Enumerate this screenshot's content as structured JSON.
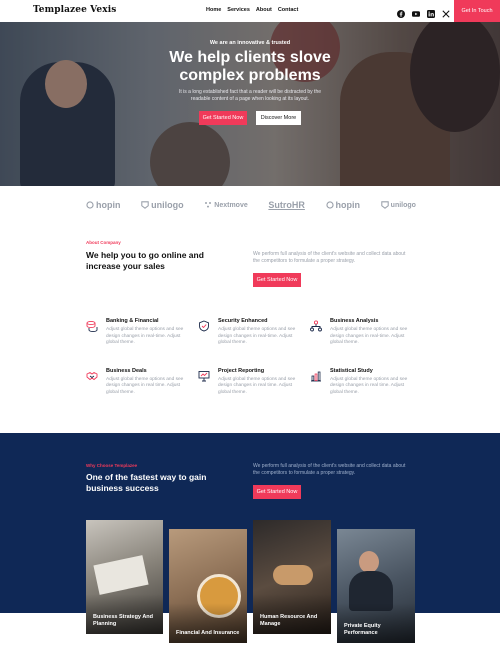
{
  "nav": {
    "brand": "Templazee Vexis",
    "menu": [
      "Home",
      "Services",
      "About",
      "Contact"
    ],
    "socials": [
      "facebook-icon",
      "youtube-icon",
      "linkedin-icon",
      "x-icon"
    ],
    "cta": "Get In Touch"
  },
  "hero": {
    "kicker": "We are an innovative & trusted",
    "title": "We help clients slove complex problems",
    "subtitle": "It is a long established fact that a reader will be distracted by the readable content of a page when looking at its layout.",
    "primary_button": "Get Started Now",
    "secondary_button": "Discover More"
  },
  "logos": [
    "hopin",
    "unilogo",
    "Nextmove",
    "SutroHR",
    "hopin",
    "unilogo"
  ],
  "about": {
    "kicker": "About Company",
    "title": "We help you to go online and increase your sales",
    "text": "We perform full analysis of the client's website and collect data about the competitors to formulate a proper strategy.",
    "button": "Get Started Now"
  },
  "features": [
    {
      "icon": "coins-icon",
      "title": "Banking & Financial",
      "desc": "Adjust global theme options and see design changes in real-time. Adjust global theme."
    },
    {
      "icon": "shield-check-icon",
      "title": "Security Enhanced",
      "desc": "Adjust global theme options and see design changes in real-time. Adjust global theme."
    },
    {
      "icon": "org-chart-icon",
      "title": "Business Analysis",
      "desc": "Adjust global theme options and see design changes in real-time. Adjust global theme."
    },
    {
      "icon": "handshake-icon",
      "title": "Business Deals",
      "desc": "Adjust global theme options and see design changes in real time. Adjust global theme."
    },
    {
      "icon": "presentation-icon",
      "title": "Project Reporting",
      "desc": "Adjust global theme options and see design changes in real time. Adjust global theme."
    },
    {
      "icon": "bar-chart-icon",
      "title": "Statistical Study",
      "desc": "Adjust global theme options and see design changes in real time. Adjust global theme."
    }
  ],
  "why": {
    "kicker": "Why Choose Templazee",
    "title": "One of the fastest way to gain business success",
    "text": "We perform full analysis of the client's website and collect data about the competitors to formulate a proper strategy.",
    "button": "Get Started Now"
  },
  "cards": [
    {
      "label": "Business Strategy And Planning"
    },
    {
      "label": "Financial And Insurance"
    },
    {
      "label": "Human Resource And Manage"
    },
    {
      "label": "Private Equity Performance"
    }
  ],
  "colors": {
    "accent": "#f03a5a",
    "navy": "#0f2856",
    "muted": "#9aa0aa"
  }
}
